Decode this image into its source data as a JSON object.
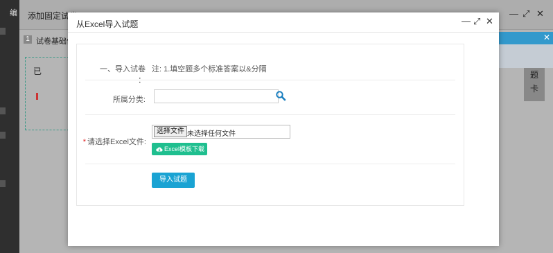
{
  "background": {
    "edge_char": "编",
    "window_title": "添加固定试卷",
    "step_number": "1",
    "step_text": "试卷基础信息",
    "left_char": "已",
    "card_chars": [
      "题",
      "卡"
    ],
    "colors": {
      "accent_blue": "#3399cc",
      "dashed_border": "#3a9a88"
    }
  },
  "dialog": {
    "title": "从Excel导入试题",
    "controls": {
      "minimize_icon": "minimize-icon",
      "maximize_icon": "maximize-icon",
      "close_icon": "close-icon"
    },
    "form": {
      "import_label": "一、导入试卷 ：",
      "note": "注: 1.填空题多个标准答案以&分隔",
      "category_label": "所属分类:",
      "category_value": "",
      "required_mark": "*",
      "file_label": "请选择Excel文件:",
      "file_button": "选择文件",
      "file_status": "未选择任何文件",
      "download_button": "Excel模板下载",
      "import_button": "导入试题"
    },
    "colors": {
      "download_green": "#1fbf8f",
      "import_blue": "#1aa3d3",
      "required_red": "#e02020"
    }
  }
}
